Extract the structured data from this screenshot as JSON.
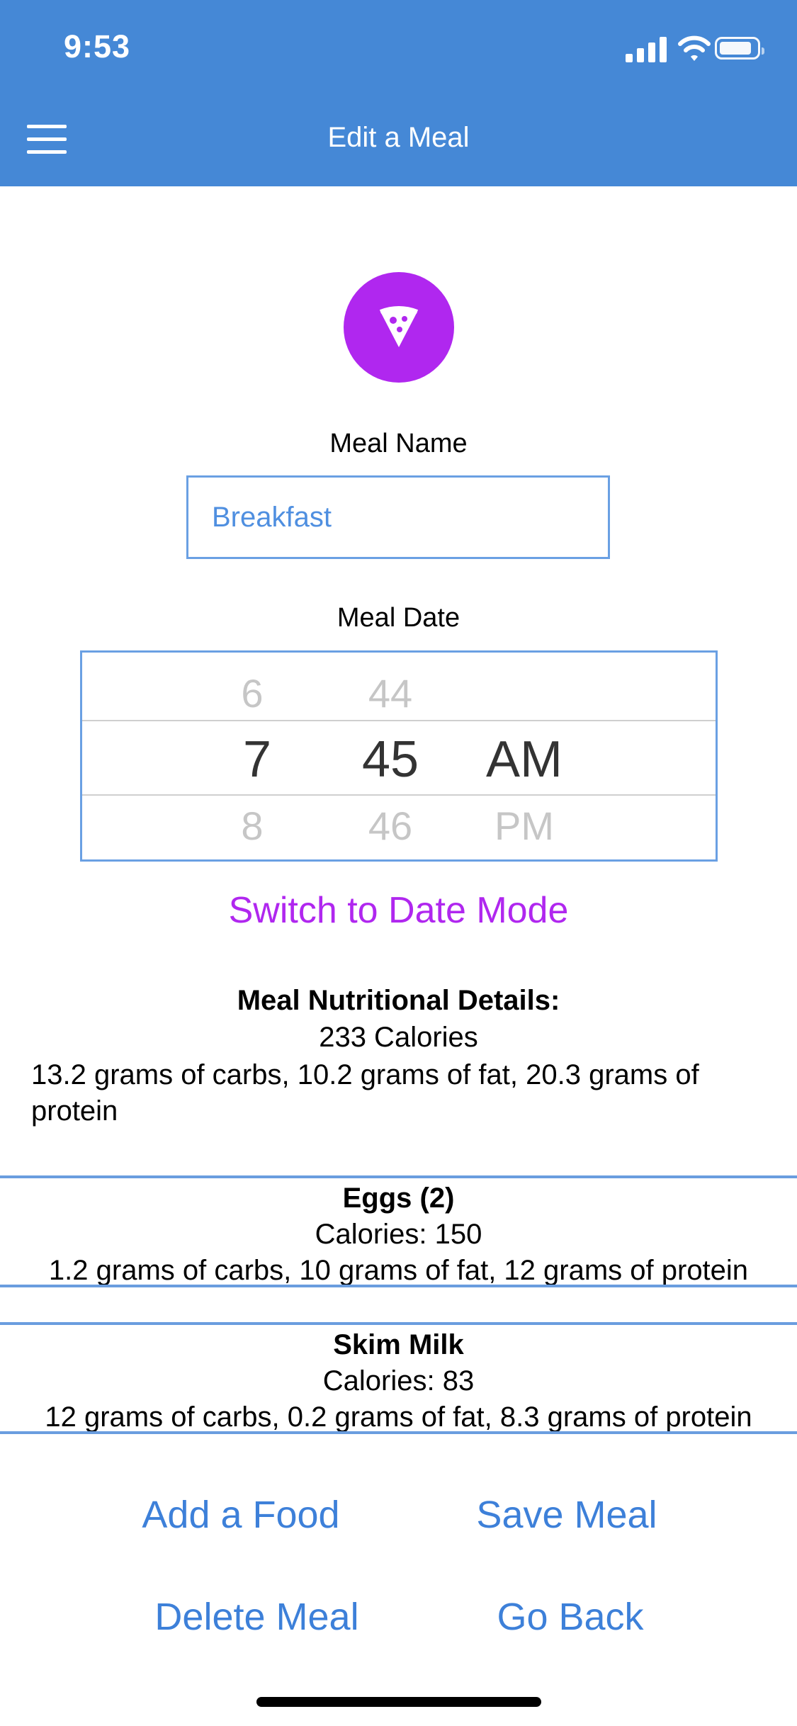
{
  "status_bar": {
    "time": "9:53"
  },
  "header": {
    "title": "Edit a Meal"
  },
  "icons": {
    "menu": "menu-icon",
    "meal": "pizza-slice-icon",
    "signal": "signal-icon",
    "wifi": "wifi-icon",
    "battery": "battery-icon"
  },
  "colors": {
    "header": "#4588d6",
    "accent_purple": "#b027ef",
    "link_blue": "#3d80d9",
    "border_blue": "#6aa0e3"
  },
  "meal_name": {
    "label": "Meal Name",
    "value": "Breakfast"
  },
  "meal_date": {
    "label": "Meal Date",
    "picker": {
      "hour": {
        "above": "6",
        "selected": "7",
        "below": "8"
      },
      "minute": {
        "above": "44",
        "selected": "45",
        "below": "46"
      },
      "period": {
        "above": "",
        "selected": "AM",
        "below": "PM"
      }
    }
  },
  "switch_mode": {
    "label": "Switch to Date Mode"
  },
  "nutrition": {
    "title": "Meal Nutritional Details:",
    "calories": "233 Calories",
    "macros": "13.2 grams of carbs, 10.2 grams of fat, 20.3 grams of protein"
  },
  "foods": [
    {
      "name": "Eggs (2)",
      "calories": "Calories: 150",
      "macros": "1.2 grams of carbs, 10 grams of fat, 12 grams of protein"
    },
    {
      "name": "Skim Milk",
      "calories": "Calories: 83",
      "macros": "12 grams of carbs, 0.2 grams of fat, 8.3 grams of protein"
    }
  ],
  "actions": {
    "add_food": "Add a Food",
    "save_meal": "Save Meal",
    "delete_meal": "Delete Meal",
    "go_back": "Go Back"
  }
}
